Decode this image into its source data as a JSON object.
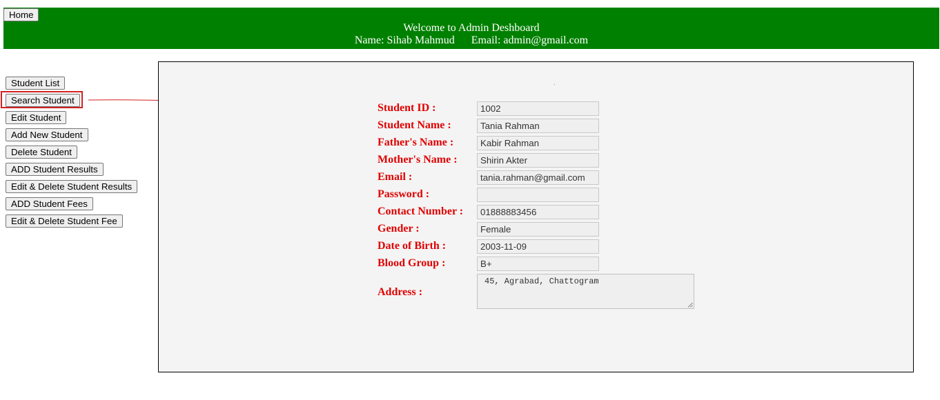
{
  "header": {
    "home_label": "Home",
    "welcome": "Welcome to Admin Deshboard",
    "user_line": "Name: Sihab Mahmud      Email: admin@gmail.com",
    "background": "#008000"
  },
  "sidebar": {
    "items": [
      {
        "label": "Student List"
      },
      {
        "label": "Search Student"
      },
      {
        "label": "Edit Student"
      },
      {
        "label": "Add New Student"
      },
      {
        "label": "Delete Student"
      },
      {
        "label": "ADD Student Results"
      },
      {
        "label": "Edit & Delete Student Results"
      },
      {
        "label": "ADD Student Fees"
      },
      {
        "label": "Edit & Delete Student Fee"
      }
    ]
  },
  "annotation": {
    "highlight_color": "#d42020",
    "icon": "hand-drawn-arrow-icon"
  },
  "form": {
    "label_color": "#e00000",
    "fields": [
      {
        "label": "Student ID :",
        "value": "1002"
      },
      {
        "label": "Student Name :",
        "value": "Tania Rahman"
      },
      {
        "label": "Father's Name :",
        "value": "Kabir Rahman"
      },
      {
        "label": "Mother's Name :",
        "value": "Shirin Akter"
      },
      {
        "label": "Email :",
        "value": "tania.rahman@gmail.com"
      },
      {
        "label": "Password :",
        "value": ""
      },
      {
        "label": "Contact Number :",
        "value": "01888883456"
      },
      {
        "label": "Gender :",
        "value": "Female"
      },
      {
        "label": "Date of Birth :",
        "value": "2003-11-09"
      },
      {
        "label": "Blood Group :",
        "value": "B+"
      }
    ],
    "address": {
      "label": "Address :",
      "value": "45, Agrabad, Chattogram"
    }
  }
}
